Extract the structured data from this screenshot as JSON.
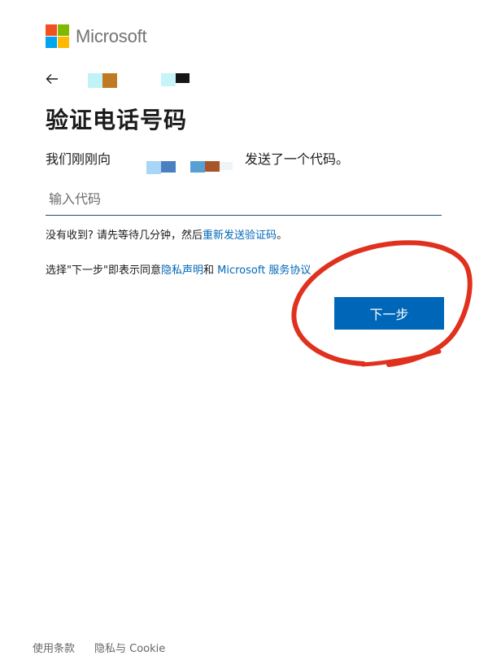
{
  "brand": {
    "name": "Microsoft",
    "logo_colors": [
      "#f25022",
      "#7fba00",
      "#00a4ef",
      "#ffb900"
    ],
    "logo_icon": "microsoft-logo-icon"
  },
  "header": {
    "back_icon": "arrow-left-icon"
  },
  "main": {
    "title": "验证电话号码",
    "sent_prefix": "我们刚刚向",
    "sent_suffix": "发送了一个代码。",
    "code_input": {
      "value": "",
      "placeholder": "输入代码"
    },
    "resend_text": "没有收到? 请先等待几分钟，然后",
    "resend_link": "重新发送验证码",
    "resend_end": "。",
    "terms_prefix": "选择\"下一步\"即表示同意",
    "privacy_link": "隐私声明",
    "terms_and": "和",
    "service_link": "Microsoft 服务协议",
    "next_button": "下一步"
  },
  "footer": {
    "terms_of_use": "使用条款",
    "privacy_cookie": "隐私与 Cookie"
  },
  "colors": {
    "accent": "#0067b8",
    "input_border": "#1a4e73",
    "annotation": "#e0301e"
  }
}
